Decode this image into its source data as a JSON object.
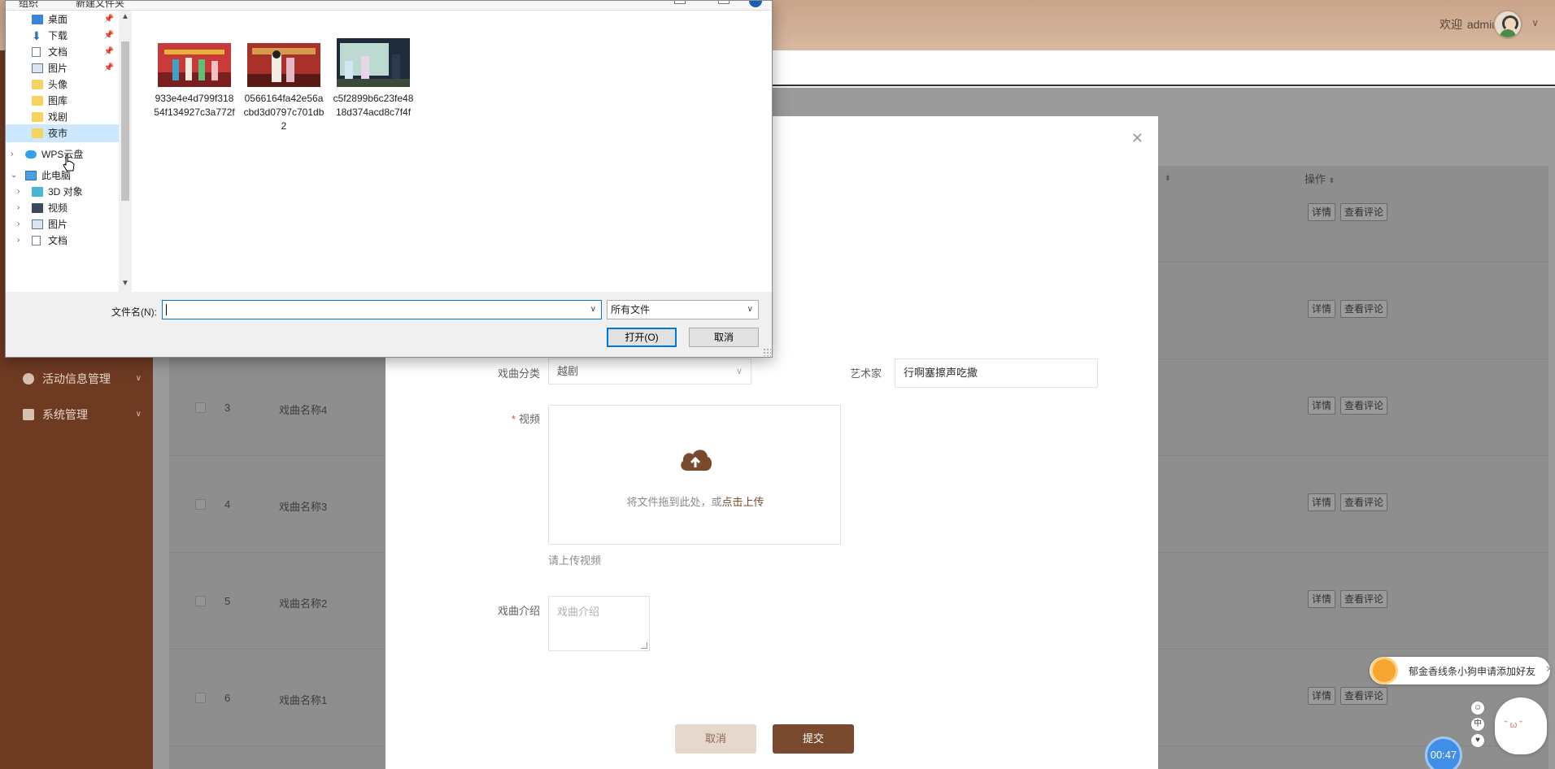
{
  "header": {
    "welcome_prefix": "欢迎",
    "username": "admin"
  },
  "sidebar": {
    "items": [
      {
        "label": "活动信息管理"
      },
      {
        "label": "系统管理"
      }
    ]
  },
  "table": {
    "header_op": "操作",
    "rows": [
      {
        "index": "",
        "name": ""
      },
      {
        "index": "",
        "name": ""
      },
      {
        "index": "3",
        "name": "戏曲名称4"
      },
      {
        "index": "4",
        "name": "戏曲名称3"
      },
      {
        "index": "5",
        "name": "戏曲名称2"
      },
      {
        "index": "6",
        "name": "戏曲名称1"
      }
    ],
    "btn_detail": "详情",
    "btn_comments": "查看评论"
  },
  "modal": {
    "category_label": "戏曲分类",
    "category_value": "越剧",
    "artist_label": "艺术家",
    "artist_value": "行啊塞擦声吃撒",
    "video_label": "视频",
    "upload_text": "将文件拖到此处，或",
    "upload_link": "点击上传",
    "upload_tip": "请上传视频",
    "intro_label": "戏曲介绍",
    "intro_placeholder": "戏曲介绍",
    "cancel": "取消",
    "submit": "提交"
  },
  "file_dialog": {
    "top_left_1": "组织",
    "top_left_2": "新建文件夹",
    "nav_items": [
      {
        "label": "桌面",
        "icon": "desktop-icon",
        "pinned": true
      },
      {
        "label": "下载",
        "icon": "download-icon",
        "pinned": true
      },
      {
        "label": "文档",
        "icon": "document-icon",
        "pinned": true
      },
      {
        "label": "图片",
        "icon": "picture-icon",
        "pinned": true
      },
      {
        "label": "头像",
        "icon": "folder-icon",
        "pinned": false
      },
      {
        "label": "图库",
        "icon": "folder-icon",
        "pinned": false
      },
      {
        "label": "戏剧",
        "icon": "folder-icon",
        "pinned": false
      },
      {
        "label": "夜市",
        "icon": "folder-icon",
        "pinned": false
      },
      {
        "label": "WPS云盘",
        "icon": "cloud-icon",
        "pinned": false
      },
      {
        "label": "此电脑",
        "icon": "computer-icon",
        "pinned": false
      },
      {
        "label": "3D 对象",
        "icon": "3d-objects-icon",
        "pinned": false
      },
      {
        "label": "视频",
        "icon": "video-icon",
        "pinned": false
      },
      {
        "label": "图片",
        "icon": "picture-icon",
        "pinned": false
      },
      {
        "label": "文档",
        "icon": "document-icon",
        "pinned": false
      }
    ],
    "files": [
      {
        "name": "933e4e4d799f31854f134927c3a772f"
      },
      {
        "name": "0566164fa42e56acbd3d0797c701db2"
      },
      {
        "name": "c5f2899b6c23fe4818d374acd8c7f4f"
      }
    ],
    "filename_label": "文件名(N):",
    "filename_value": "",
    "filetype_value": "所有文件",
    "open_button": "打开(O)",
    "cancel_button": "取消"
  },
  "widgets": {
    "notification": "郁金香线条小狗申请添加好友",
    "timer": "00:47"
  },
  "colors": {
    "brand": "#7a4a2e",
    "sidebar": "#6e3a22",
    "accent_blue": "#0078d7"
  }
}
